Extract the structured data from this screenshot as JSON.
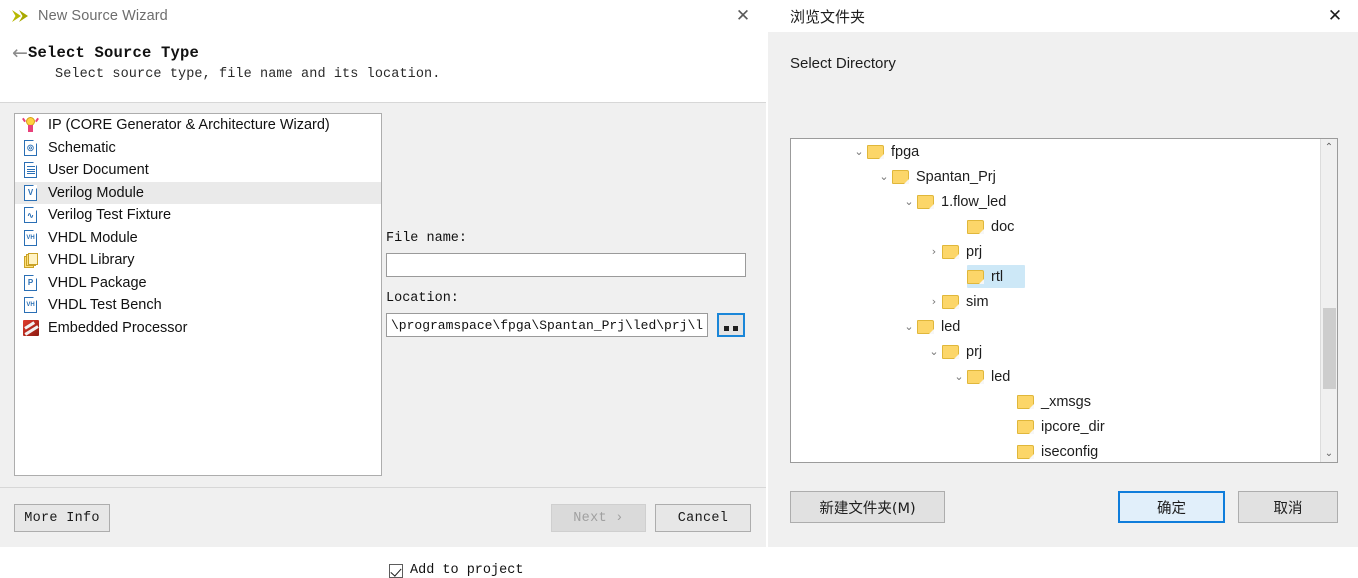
{
  "wizard": {
    "window_title": "New Source Wizard",
    "app_icon": "chevron-arrow-icon",
    "close_icon": "✕",
    "back_icon": "←",
    "page_title": "Select Source Type",
    "page_subtitle": "Select source type, file name and its location.",
    "source_types": [
      {
        "label": "IP (CORE Generator & Architecture Wizard)",
        "icon": "ip-core-icon",
        "selected": false
      },
      {
        "label": "Schematic",
        "icon": "schematic-icon",
        "selected": false
      },
      {
        "label": "User Document",
        "icon": "user-document-icon",
        "selected": false
      },
      {
        "label": "Verilog Module",
        "icon": "verilog-module-icon",
        "selected": true
      },
      {
        "label": "Verilog Test Fixture",
        "icon": "verilog-test-fixture-icon",
        "selected": false
      },
      {
        "label": "VHDL Module",
        "icon": "vhdl-module-icon",
        "selected": false
      },
      {
        "label": "VHDL Library",
        "icon": "vhdl-library-icon",
        "selected": false
      },
      {
        "label": "VHDL Package",
        "icon": "vhdl-package-icon",
        "selected": false
      },
      {
        "label": "VHDL Test Bench",
        "icon": "vhdl-test-bench-icon",
        "selected": false
      },
      {
        "label": "Embedded Processor",
        "icon": "embedded-processor-icon",
        "selected": false
      }
    ],
    "file_name_label": "File name:",
    "file_name_value": "",
    "location_label": "Location:",
    "location_value": "\\programspace\\fpga\\Spantan_Prj\\led\\prj\\led",
    "browse_button_label": "..",
    "add_to_project_label": "Add to project",
    "add_to_project_checked": true,
    "footer": {
      "more_info": "More Info",
      "next": "Next  ›",
      "next_disabled": true,
      "cancel": "Cancel"
    }
  },
  "browse_dialog": {
    "window_title": "浏览文件夹",
    "close_icon": "✕",
    "prompt": "Select Directory",
    "tree": [
      {
        "label": "fpga",
        "depth": 0,
        "twisty": "⌄",
        "selected": false
      },
      {
        "label": "Spantan_Prj",
        "depth": 1,
        "twisty": "⌄",
        "selected": false
      },
      {
        "label": "1.flow_led",
        "depth": 2,
        "twisty": "⌄",
        "selected": false
      },
      {
        "label": "doc",
        "depth": 4,
        "twisty": "",
        "selected": false
      },
      {
        "label": "prj",
        "depth": 3,
        "twisty": "›",
        "selected": false
      },
      {
        "label": "rtl",
        "depth": 4,
        "twisty": "",
        "selected": true
      },
      {
        "label": "sim",
        "depth": 3,
        "twisty": "›",
        "selected": false
      },
      {
        "label": "led",
        "depth": 2,
        "twisty": "⌄",
        "selected": false
      },
      {
        "label": "prj",
        "depth": 3,
        "twisty": "⌄",
        "selected": false
      },
      {
        "label": "led",
        "depth": 4,
        "twisty": "⌄",
        "selected": false
      },
      {
        "label": "_xmsgs",
        "depth": 6,
        "twisty": "",
        "selected": false
      },
      {
        "label": "ipcore_dir",
        "depth": 6,
        "twisty": "",
        "selected": false
      },
      {
        "label": "iseconfig",
        "depth": 6,
        "twisty": "",
        "selected": false
      }
    ],
    "scroll": {
      "up_icon": "⌃",
      "down_icon": "⌄",
      "thumb_top_pct": 47,
      "thumb_height_pct": 25
    },
    "buttons": {
      "new_folder": "新建文件夹(M)",
      "ok": "确定",
      "cancel": "取消"
    }
  },
  "colors": {
    "accent_blue": "#0f7ddb",
    "selection_blue": "#cde8f7",
    "folder_yellow": "#fcd669",
    "dialog_bg": "#f0f0f0"
  }
}
